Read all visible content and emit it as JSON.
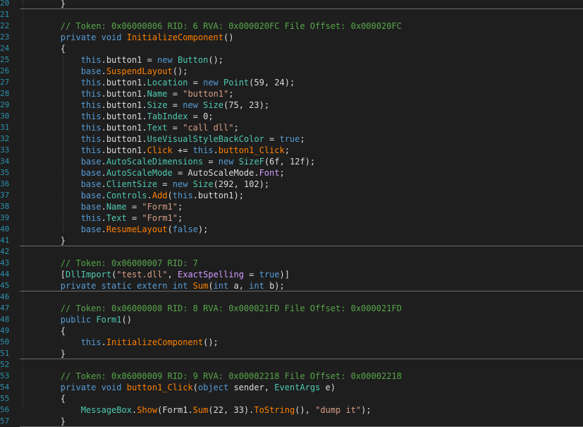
{
  "colors": {
    "background": "#1e1e1e",
    "line_number": "#2b91af",
    "comment": "#57a64a",
    "keyword": "#569cd6",
    "type": "#4ec9b0",
    "member": "#4ec9b0",
    "method": "#ff8000",
    "field": "#d19cff",
    "string": "#d69d85",
    "number": "#b5cea8",
    "text": "#dcdcdc"
  },
  "lines": [
    {
      "n": "20",
      "tokens": [
        {
          "c": "text",
          "t": "        }"
        }
      ]
    },
    {
      "n": "21",
      "tokens": []
    },
    {
      "n": "22",
      "tokens": [
        {
          "c": "comment",
          "t": "        // Token: 0x06000006 RID: 6 RVA: 0x000020FC File Offset: 0x000020FC"
        }
      ]
    },
    {
      "n": "23",
      "tokens": [
        {
          "c": "keyword",
          "t": "        private void "
        },
        {
          "c": "method",
          "t": "InitializeComponent"
        },
        {
          "c": "text",
          "t": "()"
        }
      ]
    },
    {
      "n": "24",
      "tokens": [
        {
          "c": "text",
          "t": "        {"
        }
      ]
    },
    {
      "n": "25",
      "tokens": [
        {
          "c": "keyword",
          "t": "            this"
        },
        {
          "c": "text",
          "t": ".button1 = "
        },
        {
          "c": "keyword",
          "t": "new "
        },
        {
          "c": "type",
          "t": "Button"
        },
        {
          "c": "text",
          "t": "();"
        }
      ]
    },
    {
      "n": "26",
      "tokens": [
        {
          "c": "keyword",
          "t": "            base"
        },
        {
          "c": "text",
          "t": "."
        },
        {
          "c": "method",
          "t": "SuspendLayout"
        },
        {
          "c": "text",
          "t": "();"
        }
      ]
    },
    {
      "n": "27",
      "tokens": [
        {
          "c": "keyword",
          "t": "            this"
        },
        {
          "c": "text",
          "t": ".button1."
        },
        {
          "c": "member",
          "t": "Location"
        },
        {
          "c": "text",
          "t": " = "
        },
        {
          "c": "keyword",
          "t": "new "
        },
        {
          "c": "type",
          "t": "Point"
        },
        {
          "c": "text",
          "t": "(59, 24);"
        }
      ]
    },
    {
      "n": "28",
      "tokens": [
        {
          "c": "keyword",
          "t": "            this"
        },
        {
          "c": "text",
          "t": ".button1."
        },
        {
          "c": "member",
          "t": "Name"
        },
        {
          "c": "text",
          "t": " = "
        },
        {
          "c": "string",
          "t": "\"button1\""
        },
        {
          "c": "text",
          "t": ";"
        }
      ]
    },
    {
      "n": "29",
      "tokens": [
        {
          "c": "keyword",
          "t": "            this"
        },
        {
          "c": "text",
          "t": ".button1."
        },
        {
          "c": "member",
          "t": "Size"
        },
        {
          "c": "text",
          "t": " = "
        },
        {
          "c": "keyword",
          "t": "new "
        },
        {
          "c": "type",
          "t": "Size"
        },
        {
          "c": "text",
          "t": "(75, 23);"
        }
      ]
    },
    {
      "n": "30",
      "tokens": [
        {
          "c": "keyword",
          "t": "            this"
        },
        {
          "c": "text",
          "t": ".button1."
        },
        {
          "c": "member",
          "t": "TabIndex"
        },
        {
          "c": "text",
          "t": " = 0;"
        }
      ]
    },
    {
      "n": "31",
      "tokens": [
        {
          "c": "keyword",
          "t": "            this"
        },
        {
          "c": "text",
          "t": ".button1."
        },
        {
          "c": "member",
          "t": "Text"
        },
        {
          "c": "text",
          "t": " = "
        },
        {
          "c": "string",
          "t": "\"call dll\""
        },
        {
          "c": "text",
          "t": ";"
        }
      ]
    },
    {
      "n": "32",
      "tokens": [
        {
          "c": "keyword",
          "t": "            this"
        },
        {
          "c": "text",
          "t": ".button1."
        },
        {
          "c": "member",
          "t": "UseVisualStyleBackColor"
        },
        {
          "c": "text",
          "t": " = "
        },
        {
          "c": "keyword",
          "t": "true"
        },
        {
          "c": "text",
          "t": ";"
        }
      ]
    },
    {
      "n": "33",
      "tokens": [
        {
          "c": "keyword",
          "t": "            this"
        },
        {
          "c": "text",
          "t": ".button1."
        },
        {
          "c": "method",
          "t": "Click"
        },
        {
          "c": "text",
          "t": " += "
        },
        {
          "c": "keyword",
          "t": "this"
        },
        {
          "c": "text",
          "t": "."
        },
        {
          "c": "method",
          "t": "button1_Click"
        },
        {
          "c": "text",
          "t": ";"
        }
      ]
    },
    {
      "n": "34",
      "tokens": [
        {
          "c": "keyword",
          "t": "            base"
        },
        {
          "c": "text",
          "t": "."
        },
        {
          "c": "member",
          "t": "AutoScaleDimensions"
        },
        {
          "c": "text",
          "t": " = "
        },
        {
          "c": "keyword",
          "t": "new "
        },
        {
          "c": "type",
          "t": "SizeF"
        },
        {
          "c": "text",
          "t": "(6f, 12f);"
        }
      ]
    },
    {
      "n": "35",
      "tokens": [
        {
          "c": "keyword",
          "t": "            base"
        },
        {
          "c": "text",
          "t": "."
        },
        {
          "c": "member",
          "t": "AutoScaleMode"
        },
        {
          "c": "text",
          "t": " = AutoScaleMode."
        },
        {
          "c": "field",
          "t": "Font"
        },
        {
          "c": "text",
          "t": ";"
        }
      ]
    },
    {
      "n": "36",
      "tokens": [
        {
          "c": "keyword",
          "t": "            base"
        },
        {
          "c": "text",
          "t": "."
        },
        {
          "c": "member",
          "t": "ClientSize"
        },
        {
          "c": "text",
          "t": " = "
        },
        {
          "c": "keyword",
          "t": "new "
        },
        {
          "c": "type",
          "t": "Size"
        },
        {
          "c": "text",
          "t": "(292, 102);"
        }
      ]
    },
    {
      "n": "37",
      "tokens": [
        {
          "c": "keyword",
          "t": "            base"
        },
        {
          "c": "text",
          "t": "."
        },
        {
          "c": "member",
          "t": "Controls"
        },
        {
          "c": "text",
          "t": "."
        },
        {
          "c": "method",
          "t": "Add"
        },
        {
          "c": "text",
          "t": "("
        },
        {
          "c": "keyword",
          "t": "this"
        },
        {
          "c": "text",
          "t": ".button1);"
        }
      ]
    },
    {
      "n": "38",
      "tokens": [
        {
          "c": "keyword",
          "t": "            base"
        },
        {
          "c": "text",
          "t": "."
        },
        {
          "c": "member",
          "t": "Name"
        },
        {
          "c": "text",
          "t": " = "
        },
        {
          "c": "string",
          "t": "\"Form1\""
        },
        {
          "c": "text",
          "t": ";"
        }
      ]
    },
    {
      "n": "39",
      "tokens": [
        {
          "c": "keyword",
          "t": "            this"
        },
        {
          "c": "text",
          "t": "."
        },
        {
          "c": "member",
          "t": "Text"
        },
        {
          "c": "text",
          "t": " = "
        },
        {
          "c": "string",
          "t": "\"Form1\""
        },
        {
          "c": "text",
          "t": ";"
        }
      ]
    },
    {
      "n": "40",
      "tokens": [
        {
          "c": "keyword",
          "t": "            base"
        },
        {
          "c": "text",
          "t": "."
        },
        {
          "c": "method",
          "t": "ResumeLayout"
        },
        {
          "c": "text",
          "t": "("
        },
        {
          "c": "keyword",
          "t": "false"
        },
        {
          "c": "text",
          "t": ");"
        }
      ]
    },
    {
      "n": "41",
      "tokens": [
        {
          "c": "text",
          "t": "        }"
        }
      ]
    },
    {
      "n": "42",
      "tokens": []
    },
    {
      "n": "43",
      "tokens": [
        {
          "c": "comment",
          "t": "        // Token: 0x06000007 RID: 7"
        }
      ]
    },
    {
      "n": "44",
      "tokens": [
        {
          "c": "text",
          "t": "        ["
        },
        {
          "c": "type",
          "t": "DllImport"
        },
        {
          "c": "text",
          "t": "("
        },
        {
          "c": "string",
          "t": "\"test.dll\""
        },
        {
          "c": "text",
          "t": ", "
        },
        {
          "c": "field",
          "t": "ExactSpelling"
        },
        {
          "c": "text",
          "t": " = "
        },
        {
          "c": "keyword",
          "t": "true"
        },
        {
          "c": "text",
          "t": ")]"
        }
      ]
    },
    {
      "n": "45",
      "tokens": [
        {
          "c": "keyword",
          "t": "        private static extern int "
        },
        {
          "c": "method",
          "t": "Sum"
        },
        {
          "c": "text",
          "t": "("
        },
        {
          "c": "keyword",
          "t": "int "
        },
        {
          "c": "text",
          "t": "a, "
        },
        {
          "c": "keyword",
          "t": "int "
        },
        {
          "c": "text",
          "t": "b);"
        }
      ]
    },
    {
      "n": "46",
      "tokens": []
    },
    {
      "n": "47",
      "tokens": [
        {
          "c": "comment",
          "t": "        // Token: 0x06000008 RID: 8 RVA: 0x000021FD File Offset: 0x000021FD"
        }
      ]
    },
    {
      "n": "48",
      "tokens": [
        {
          "c": "keyword",
          "t": "        public "
        },
        {
          "c": "type",
          "t": "Form1"
        },
        {
          "c": "text",
          "t": "()"
        }
      ]
    },
    {
      "n": "49",
      "tokens": [
        {
          "c": "text",
          "t": "        {"
        }
      ]
    },
    {
      "n": "50",
      "tokens": [
        {
          "c": "keyword",
          "t": "            this"
        },
        {
          "c": "text",
          "t": "."
        },
        {
          "c": "method",
          "t": "InitializeComponent"
        },
        {
          "c": "text",
          "t": "();"
        }
      ]
    },
    {
      "n": "51",
      "tokens": [
        {
          "c": "text",
          "t": "        }"
        }
      ]
    },
    {
      "n": "52",
      "tokens": []
    },
    {
      "n": "53",
      "tokens": [
        {
          "c": "comment",
          "t": "        // Token: 0x06000009 RID: 9 RVA: 0x00002218 File Offset: 0x00002218"
        }
      ]
    },
    {
      "n": "54",
      "tokens": [
        {
          "c": "keyword",
          "t": "        private void "
        },
        {
          "c": "method",
          "t": "button1_Click"
        },
        {
          "c": "text",
          "t": "("
        },
        {
          "c": "keyword",
          "t": "object "
        },
        {
          "c": "text",
          "t": "sender, "
        },
        {
          "c": "type",
          "t": "EventArgs"
        },
        {
          "c": "text",
          "t": " e)"
        }
      ]
    },
    {
      "n": "55",
      "tokens": [
        {
          "c": "text",
          "t": "        {"
        }
      ]
    },
    {
      "n": "56",
      "tokens": [
        {
          "c": "type",
          "t": "            MessageBox"
        },
        {
          "c": "text",
          "t": "."
        },
        {
          "c": "method",
          "t": "Show"
        },
        {
          "c": "text",
          "t": "(Form1."
        },
        {
          "c": "method",
          "t": "Sum"
        },
        {
          "c": "text",
          "t": "(22, 33)."
        },
        {
          "c": "method",
          "t": "ToString"
        },
        {
          "c": "text",
          "t": "(), "
        },
        {
          "c": "string",
          "t": "\"dump it\""
        },
        {
          "c": "text",
          "t": ");"
        }
      ]
    },
    {
      "n": "57",
      "tokens": [
        {
          "c": "text",
          "t": "        }"
        }
      ]
    }
  ],
  "separators_after": [
    "20",
    "41",
    "45",
    "51",
    "57"
  ]
}
